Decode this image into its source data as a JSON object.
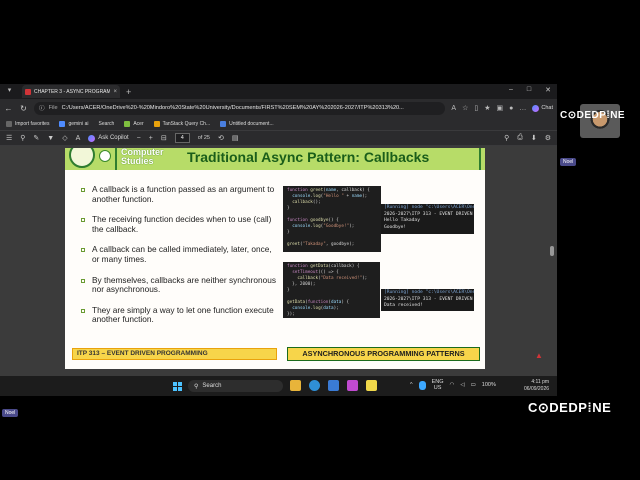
{
  "tab": {
    "title": "CHAPTER 3 - ASYNC PROGRAMM",
    "close": "×",
    "new_tab": "+"
  },
  "window": {
    "minimize": "–",
    "maximize": "□",
    "close": "✕"
  },
  "address": {
    "file_label": "File",
    "url": "C:/Users/ACER/OneDrive%20-%20Mindoro%20State%20University/Documents/FIRST%20SEM%20AY%202026-2027/ITP%20313%20...",
    "chat_label": "Chat"
  },
  "bookmarks": [
    {
      "label": "Import favorites"
    },
    {
      "label": "gemini ai"
    },
    {
      "label": "Search"
    },
    {
      "label": "Acer"
    },
    {
      "label": "TanStack Query Ch..."
    },
    {
      "label": "Untitled document..."
    }
  ],
  "pdf_toolbar": {
    "copilot_label": "Ask Copilot",
    "page_current": "4",
    "page_total": "of 25"
  },
  "slide": {
    "dept": "Computer\nStudies",
    "title": "Traditional Async Pattern: Callbacks",
    "bullets": [
      "A callback is a function passed as an argument to another function.",
      "The receiving function decides when to use (call) the callback.",
      "A callback can be called immediately, later, once, or many times.",
      "By themselves, callbacks are neither synchronous nor asynchronous.",
      "They are simply a way to let one function execute another function."
    ],
    "code1": [
      "function greet(name, callback) {",
      "  console.log(\"Hello \" + name);",
      "  callback();",
      "}",
      "",
      "function goodbye() {",
      "  console.log(\"Goodbye!\");",
      "}",
      "",
      "greet(\"Takaday\", goodbye);"
    ],
    "term1": [
      "[Running] node \"c:\\Users\\ACER\\One",
      "2026-2027\\ITP 313 - EVENT DRIVEN",
      "Hello Takaday",
      "Goodbye!"
    ],
    "code2": [
      "function getData(callback) {",
      "  setTimeout(() => {",
      "    callback(\"Data received!\");",
      "  }, 2000);",
      "}",
      "",
      "getData(function(data) {",
      "  console.log(data);",
      "});"
    ],
    "term2": [
      "[Running] node \"c:\\Users\\ACER\\One",
      "2026-2027\\ITP 313 - EVENT DRIVEN",
      "Data received!"
    ],
    "footer_left": "ITP 313 – EVENT DRIVEN PROGRAMMING",
    "footer_right": "ASYNCHRONOUS PROGRAMMING PATTERNS"
  },
  "taskbar": {
    "search_label": "Search",
    "lang": "ENG",
    "region": "US",
    "battery": "100%",
    "time": "4:11 pm",
    "date": "06/09/2026"
  },
  "overlay": {
    "brand_top": "C⊙DEDP⁞NE",
    "brand_bottom": "C⊙DEDP⁞NE",
    "name_tag_1": "Noel",
    "name_tag_2": "Noel"
  },
  "colors": {
    "slide_header": "#b7dc68",
    "footer": "#f7d54a",
    "title": "#1a5e1a"
  }
}
